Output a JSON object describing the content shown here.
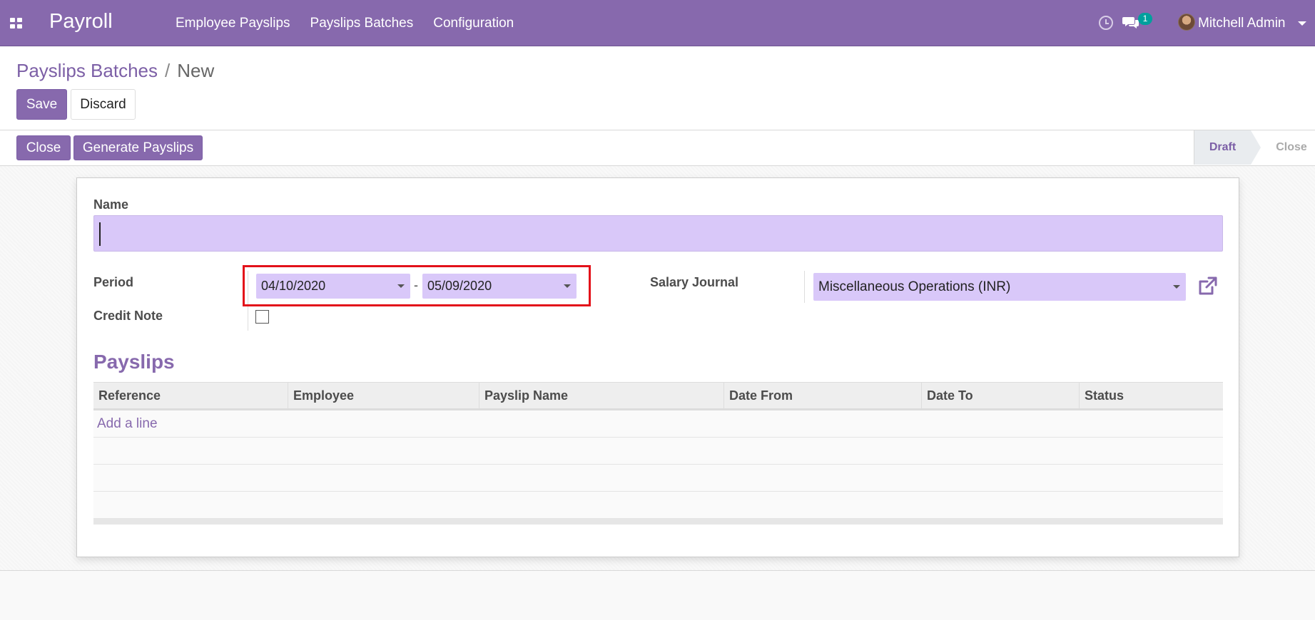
{
  "navbar": {
    "app_name": "Payroll",
    "menu": [
      "Employee Payslips",
      "Payslips Batches",
      "Configuration"
    ],
    "chat_count": "1",
    "user_name": "Mitchell Admin"
  },
  "breadcrumb": {
    "parent": "Payslips Batches",
    "separator": "/",
    "current": "New"
  },
  "actions": {
    "save": "Save",
    "discard": "Discard"
  },
  "statusbar": {
    "close_button": "Close",
    "generate_button": "Generate Payslips",
    "stages": [
      "Draft",
      "Close"
    ],
    "active_stage": "Draft"
  },
  "form": {
    "name_label": "Name",
    "name_value": "",
    "period_label": "Period",
    "date_from": "04/10/2020",
    "date_separator": "-",
    "date_to": "05/09/2020",
    "credit_note_label": "Credit Note",
    "credit_note_checked": false,
    "salary_journal_label": "Salary Journal",
    "salary_journal_value": "Miscellaneous Operations (INR)"
  },
  "payslips": {
    "title": "Payslips",
    "columns": [
      "Reference",
      "Employee",
      "Payslip Name",
      "Date From",
      "Date To",
      "Status"
    ],
    "add_line": "Add a line",
    "rows": []
  },
  "colors": {
    "brand": "#8769ad",
    "field_bg": "#d9c8f9",
    "highlight": "#e3111a",
    "badge": "#00a09d"
  }
}
